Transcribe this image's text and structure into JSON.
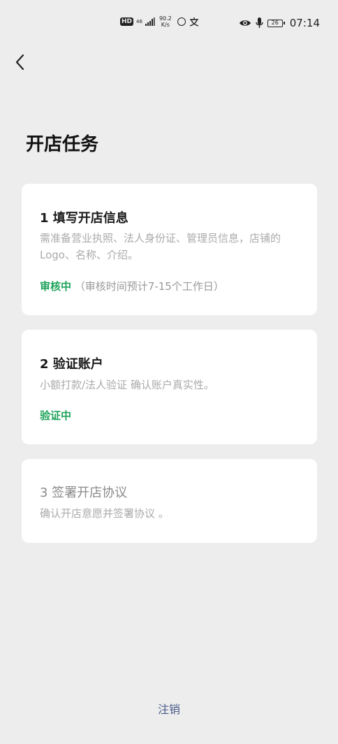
{
  "status_bar": {
    "hd": "HD",
    "network": "46",
    "speed_value": "90.2",
    "speed_unit": "K/s",
    "battery": "26",
    "time": "07:14"
  },
  "header": {
    "title": "开店任务"
  },
  "tasks": [
    {
      "title": "1 填写开店信息",
      "description": "需准备营业执照、法人身份证、管理员信息，店铺的Logo、名称、介绍。",
      "status": "审核中",
      "status_note": "（审核时间预计7-15个工作日）"
    },
    {
      "title": "2 验证账户",
      "description": "小额打款/法人验证 确认账户真实性。",
      "status": "验证中"
    },
    {
      "title": "3 签署开店协议",
      "description": "确认开店意愿并签署协议 。"
    }
  ],
  "footer": {
    "logout_label": "注销"
  },
  "colors": {
    "background": "#ededed",
    "card": "#ffffff",
    "status_green": "#1fa35a",
    "link_blue": "#4a5c8a"
  },
  "icons": {
    "back": "chevron-left-icon",
    "eye": "eye-icon",
    "mic": "microphone-icon",
    "battery": "battery-icon",
    "signal": "signal-icon"
  }
}
